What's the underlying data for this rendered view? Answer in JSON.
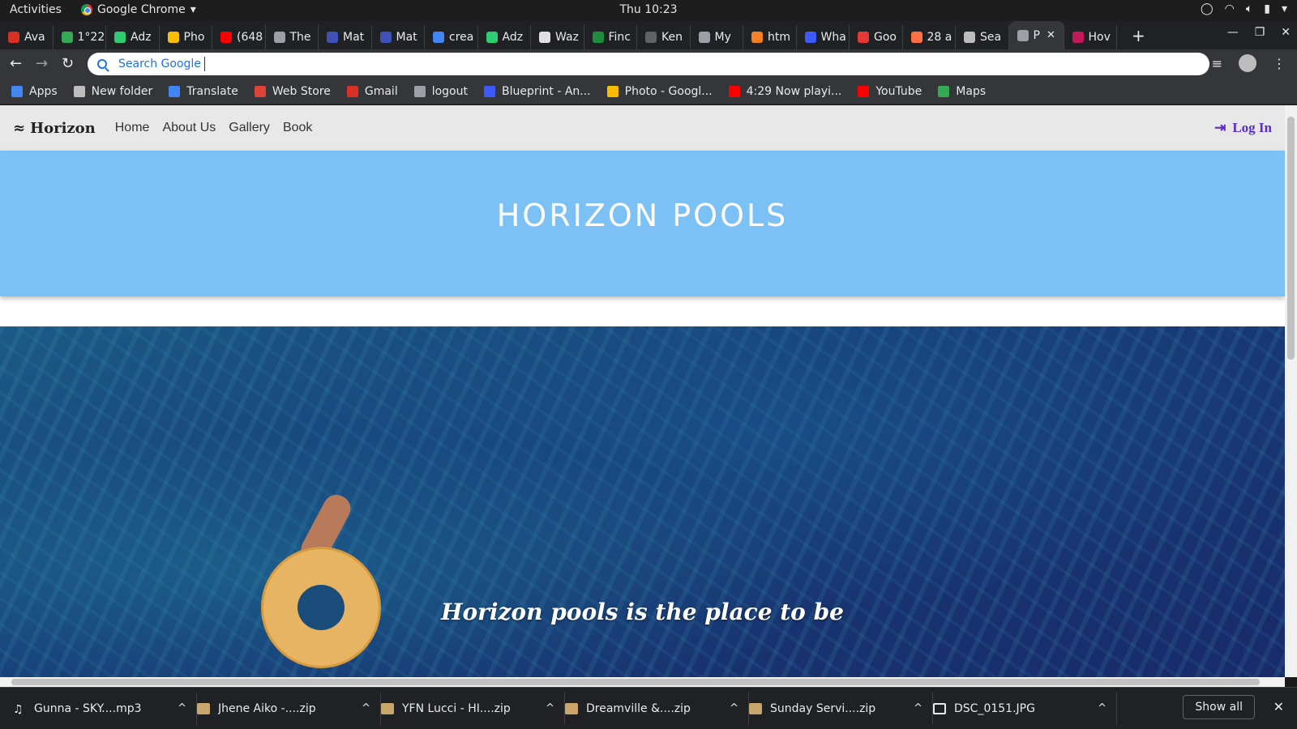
{
  "system_bar": {
    "activities": "Activities",
    "app_name": "Google Chrome",
    "clock": "Thu 10:23"
  },
  "tabs": [
    {
      "label": "Ava",
      "color": "#d93025"
    },
    {
      "label": "1°22",
      "color": "#34a853"
    },
    {
      "label": "Adz",
      "color": "#2ecc71"
    },
    {
      "label": "Pho",
      "color": "#fbbc04"
    },
    {
      "label": "(648",
      "color": "#ff0000"
    },
    {
      "label": "The",
      "color": "#9aa0a6"
    },
    {
      "label": "Mat",
      "color": "#3f51b5"
    },
    {
      "label": "Mat",
      "color": "#3f51b5"
    },
    {
      "label": "crea",
      "color": "#4285f4"
    },
    {
      "label": "Adz",
      "color": "#2ecc71"
    },
    {
      "label": "Waz",
      "color": "#e0e0e0"
    },
    {
      "label": "Finc",
      "color": "#1e8e3e"
    },
    {
      "label": "Ken",
      "color": "#5f6368"
    },
    {
      "label": "My",
      "color": "#9aa0a6"
    },
    {
      "label": "htm",
      "color": "#f48024"
    },
    {
      "label": "Wha",
      "color": "#3d5afe"
    },
    {
      "label": "Goo",
      "color": "#e53935"
    },
    {
      "label": "28 a",
      "color": "#ff7043"
    },
    {
      "label": "Sea",
      "color": "#bdbdbd"
    },
    {
      "label": "P",
      "color": "#9aa0a6",
      "active": true
    },
    {
      "label": "Hov",
      "color": "#c2185b"
    }
  ],
  "omnibox": {
    "text": "Search Google"
  },
  "bookmarks": [
    {
      "label": "Apps",
      "color": "#4285f4"
    },
    {
      "label": "New folder",
      "color": "#bdbdbd"
    },
    {
      "label": "Translate",
      "color": "#4285f4"
    },
    {
      "label": "Web Store",
      "color": "#db4437"
    },
    {
      "label": "Gmail",
      "color": "#d93025"
    },
    {
      "label": "logout",
      "color": "#9aa0a6"
    },
    {
      "label": "Blueprint - An...",
      "color": "#3d5afe"
    },
    {
      "label": "Photo - Googl...",
      "color": "#fbbc04"
    },
    {
      "label": "4:29 Now playi...",
      "color": "#ff0000"
    },
    {
      "label": "YouTube",
      "color": "#ff0000"
    },
    {
      "label": "Maps",
      "color": "#34a853"
    }
  ],
  "site": {
    "brand": "Horizon",
    "nav": [
      "Home",
      "About Us",
      "Gallery",
      "Book"
    ],
    "login": "Log In",
    "hero_title": "HORIZON POOLS",
    "tagline": "Horizon pools is the place to be",
    "colors": {
      "hero": "#7bc1f5",
      "login": "#5b2ad0"
    }
  },
  "downloads": [
    {
      "name": "Gunna - SKY....mp3",
      "type": "audio"
    },
    {
      "name": "Jhene Aiko -....zip",
      "type": "archive"
    },
    {
      "name": "YFN Lucci - HI....zip",
      "type": "archive"
    },
    {
      "name": "Dreamville &....zip",
      "type": "archive"
    },
    {
      "name": "Sunday Servi....zip",
      "type": "archive"
    },
    {
      "name": "DSC_0151.JPG",
      "type": "image"
    }
  ],
  "download_shelf": {
    "show_all": "Show all"
  }
}
